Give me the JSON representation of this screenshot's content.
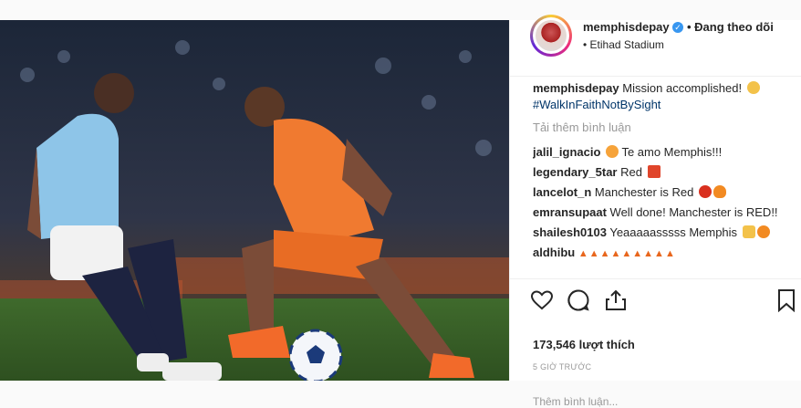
{
  "post": {
    "username": "memphisdepay",
    "follow_status": "• Đang theo dõi",
    "location": "Etihad Stadium",
    "caption_text": "Mission accomplished!",
    "hashtag": "#WalkInFaithNotBySight",
    "load_more": "Tải thêm bình luận",
    "comments": [
      {
        "user": "jalil_ignacio",
        "text": "Te amo Memphis!!!"
      },
      {
        "user": "legendary_5tar",
        "text": "Red"
      },
      {
        "user": "lancelot_n",
        "text": "Manchester is Red"
      },
      {
        "user": "emransupaat",
        "text": "Well done! Manchester is RED!!"
      },
      {
        "user": "shailesh0103",
        "text": "Yeaaaaasssss Memphis"
      },
      {
        "user": "aldhibu",
        "text": ""
      }
    ],
    "likes": "173,546 lượt thích",
    "time": "5 GIỜ TRƯỚC",
    "add_comment_placeholder": "Thêm bình luận..."
  },
  "colors": {
    "link": "#003569",
    "verified": "#3897f0",
    "muted": "#999999"
  }
}
